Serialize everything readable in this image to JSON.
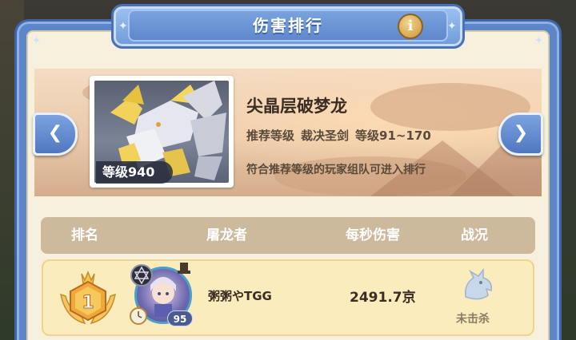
{
  "window": {
    "title": "伤害排行",
    "info_icon": "i"
  },
  "boss": {
    "name": "尖晶层破梦龙",
    "level_label": "等级940",
    "recommend_label": "推荐等级",
    "recommend_weapon": "裁决圣剑",
    "recommend_range": "等级91~170",
    "note": "符合推荐等级的玩家组队可进入排行"
  },
  "nav": {
    "prev_icon": "chevron-left-icon",
    "next_icon": "chevron-right-icon"
  },
  "table": {
    "headers": [
      "排名",
      "屠龙者",
      "每秒伤害",
      "战况"
    ],
    "rows": [
      {
        "rank": "1",
        "avatar_level": "95",
        "player": "粥粥やTGG",
        "damage_per_second": "2491.7京",
        "status": "未击杀"
      }
    ]
  },
  "colors": {
    "frame_blue": "#5d86c9",
    "panel_bg": "#f7f0dd",
    "header_bg": "#cdb99c",
    "row_bg": "#fbecbd",
    "rank_gold": "#e9a93a"
  }
}
